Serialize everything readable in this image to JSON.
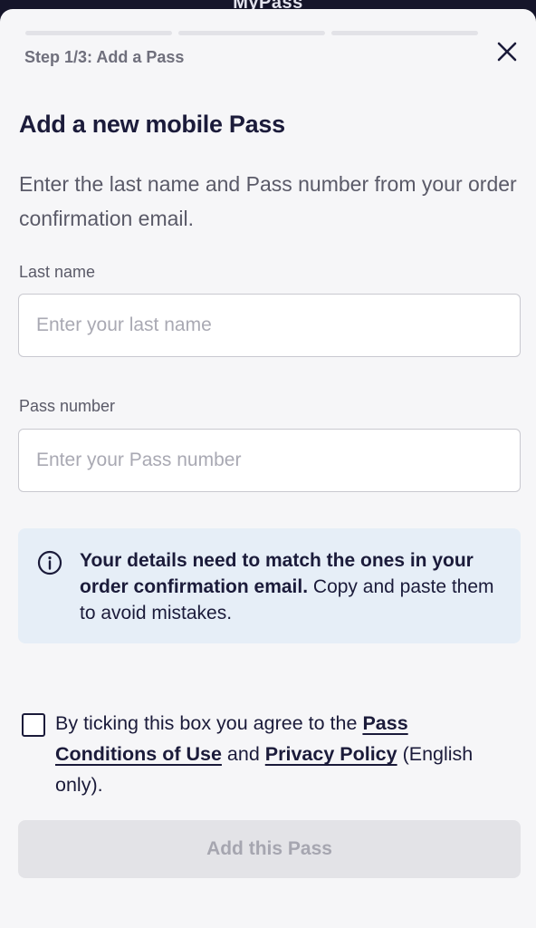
{
  "backdrop": {
    "app_title": "MyPass"
  },
  "header": {
    "step_label": "Step 1/3: Add a Pass",
    "progress": {
      "total_steps": 3,
      "current_step": 1
    },
    "close_icon": "close-icon"
  },
  "form": {
    "title": "Add a new mobile Pass",
    "subtitle": "Enter the last name and Pass number from your order confirmation email.",
    "last_name": {
      "label": "Last name",
      "placeholder": "Enter your last name",
      "value": ""
    },
    "pass_number": {
      "label": "Pass number",
      "placeholder": "Enter your Pass number",
      "value": ""
    }
  },
  "info": {
    "icon": "info-icon",
    "bold_text": "Your details need to match the ones in your order confirmation email.",
    "text": "Copy and paste them to avoid mistakes."
  },
  "agreement": {
    "checked": false,
    "text_before": "By ticking this box you agree to the",
    "link_conditions": "Pass Conditions of Use",
    "and_text": "and",
    "link_privacy": "Privacy Policy",
    "text_after": "(English only)."
  },
  "submit": {
    "label": "Add this Pass",
    "enabled": false
  },
  "colors": {
    "text_primary": "#1b1b3a",
    "text_secondary": "#5a5a68",
    "info_background": "#e6eef7",
    "button_disabled_bg": "#e3e3e7",
    "button_disabled_text": "#a6a6b0"
  }
}
